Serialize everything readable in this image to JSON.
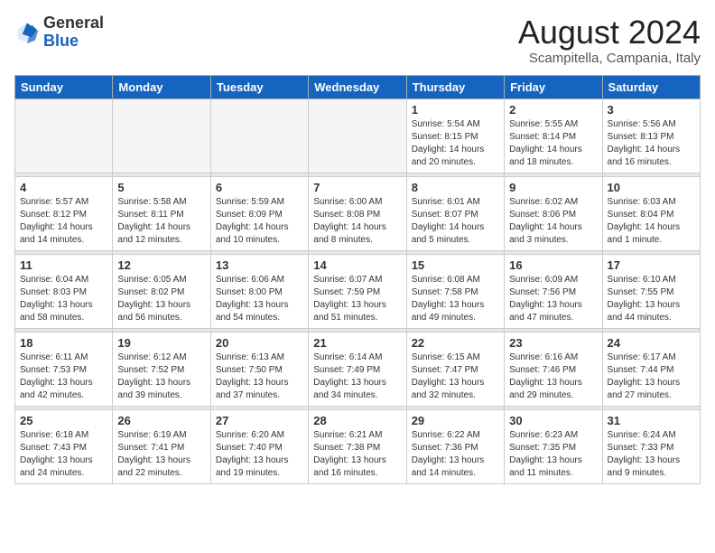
{
  "header": {
    "logo_general": "General",
    "logo_blue": "Blue",
    "month_year": "August 2024",
    "location": "Scampitella, Campania, Italy"
  },
  "days_of_week": [
    "Sunday",
    "Monday",
    "Tuesday",
    "Wednesday",
    "Thursday",
    "Friday",
    "Saturday"
  ],
  "weeks": [
    [
      {
        "day": "",
        "detail": "",
        "empty": true
      },
      {
        "day": "",
        "detail": "",
        "empty": true
      },
      {
        "day": "",
        "detail": "",
        "empty": true
      },
      {
        "day": "",
        "detail": "",
        "empty": true
      },
      {
        "day": "1",
        "detail": "Sunrise: 5:54 AM\nSunset: 8:15 PM\nDaylight: 14 hours\nand 20 minutes."
      },
      {
        "day": "2",
        "detail": "Sunrise: 5:55 AM\nSunset: 8:14 PM\nDaylight: 14 hours\nand 18 minutes."
      },
      {
        "day": "3",
        "detail": "Sunrise: 5:56 AM\nSunset: 8:13 PM\nDaylight: 14 hours\nand 16 minutes."
      }
    ],
    [
      {
        "day": "4",
        "detail": "Sunrise: 5:57 AM\nSunset: 8:12 PM\nDaylight: 14 hours\nand 14 minutes."
      },
      {
        "day": "5",
        "detail": "Sunrise: 5:58 AM\nSunset: 8:11 PM\nDaylight: 14 hours\nand 12 minutes."
      },
      {
        "day": "6",
        "detail": "Sunrise: 5:59 AM\nSunset: 8:09 PM\nDaylight: 14 hours\nand 10 minutes."
      },
      {
        "day": "7",
        "detail": "Sunrise: 6:00 AM\nSunset: 8:08 PM\nDaylight: 14 hours\nand 8 minutes."
      },
      {
        "day": "8",
        "detail": "Sunrise: 6:01 AM\nSunset: 8:07 PM\nDaylight: 14 hours\nand 5 minutes."
      },
      {
        "day": "9",
        "detail": "Sunrise: 6:02 AM\nSunset: 8:06 PM\nDaylight: 14 hours\nand 3 minutes."
      },
      {
        "day": "10",
        "detail": "Sunrise: 6:03 AM\nSunset: 8:04 PM\nDaylight: 14 hours\nand 1 minute."
      }
    ],
    [
      {
        "day": "11",
        "detail": "Sunrise: 6:04 AM\nSunset: 8:03 PM\nDaylight: 13 hours\nand 58 minutes."
      },
      {
        "day": "12",
        "detail": "Sunrise: 6:05 AM\nSunset: 8:02 PM\nDaylight: 13 hours\nand 56 minutes."
      },
      {
        "day": "13",
        "detail": "Sunrise: 6:06 AM\nSunset: 8:00 PM\nDaylight: 13 hours\nand 54 minutes."
      },
      {
        "day": "14",
        "detail": "Sunrise: 6:07 AM\nSunset: 7:59 PM\nDaylight: 13 hours\nand 51 minutes."
      },
      {
        "day": "15",
        "detail": "Sunrise: 6:08 AM\nSunset: 7:58 PM\nDaylight: 13 hours\nand 49 minutes."
      },
      {
        "day": "16",
        "detail": "Sunrise: 6:09 AM\nSunset: 7:56 PM\nDaylight: 13 hours\nand 47 minutes."
      },
      {
        "day": "17",
        "detail": "Sunrise: 6:10 AM\nSunset: 7:55 PM\nDaylight: 13 hours\nand 44 minutes."
      }
    ],
    [
      {
        "day": "18",
        "detail": "Sunrise: 6:11 AM\nSunset: 7:53 PM\nDaylight: 13 hours\nand 42 minutes."
      },
      {
        "day": "19",
        "detail": "Sunrise: 6:12 AM\nSunset: 7:52 PM\nDaylight: 13 hours\nand 39 minutes."
      },
      {
        "day": "20",
        "detail": "Sunrise: 6:13 AM\nSunset: 7:50 PM\nDaylight: 13 hours\nand 37 minutes."
      },
      {
        "day": "21",
        "detail": "Sunrise: 6:14 AM\nSunset: 7:49 PM\nDaylight: 13 hours\nand 34 minutes."
      },
      {
        "day": "22",
        "detail": "Sunrise: 6:15 AM\nSunset: 7:47 PM\nDaylight: 13 hours\nand 32 minutes."
      },
      {
        "day": "23",
        "detail": "Sunrise: 6:16 AM\nSunset: 7:46 PM\nDaylight: 13 hours\nand 29 minutes."
      },
      {
        "day": "24",
        "detail": "Sunrise: 6:17 AM\nSunset: 7:44 PM\nDaylight: 13 hours\nand 27 minutes."
      }
    ],
    [
      {
        "day": "25",
        "detail": "Sunrise: 6:18 AM\nSunset: 7:43 PM\nDaylight: 13 hours\nand 24 minutes."
      },
      {
        "day": "26",
        "detail": "Sunrise: 6:19 AM\nSunset: 7:41 PM\nDaylight: 13 hours\nand 22 minutes."
      },
      {
        "day": "27",
        "detail": "Sunrise: 6:20 AM\nSunset: 7:40 PM\nDaylight: 13 hours\nand 19 minutes."
      },
      {
        "day": "28",
        "detail": "Sunrise: 6:21 AM\nSunset: 7:38 PM\nDaylight: 13 hours\nand 16 minutes."
      },
      {
        "day": "29",
        "detail": "Sunrise: 6:22 AM\nSunset: 7:36 PM\nDaylight: 13 hours\nand 14 minutes."
      },
      {
        "day": "30",
        "detail": "Sunrise: 6:23 AM\nSunset: 7:35 PM\nDaylight: 13 hours\nand 11 minutes."
      },
      {
        "day": "31",
        "detail": "Sunrise: 6:24 AM\nSunset: 7:33 PM\nDaylight: 13 hours\nand 9 minutes."
      }
    ]
  ]
}
